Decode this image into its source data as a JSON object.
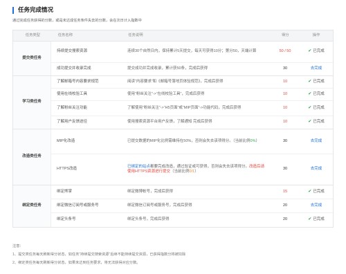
{
  "title": "任务完成情况",
  "intro": "通过完成任务获得的分数，或是未达成任务条件失去的分数，会在次日计入指数中",
  "headers": {
    "type": "任务类型",
    "name": "任务名称",
    "desc": "任务说明",
    "score": "得分",
    "op": "操作"
  },
  "groups": [
    {
      "type": "提交类任务",
      "rows": [
        {
          "name": "持续提交搜索资源",
          "desc": "连续30个自然日内，保持累计5天提交，每天可获得10分；第分50，天端计算",
          "score": "50 / 50",
          "op": "已完成"
        },
        {
          "name": "成功提交并收录完成",
          "desc": "提交成功并完成收录，累计获50条，完成后获得",
          "score": "30",
          "op": "去完成"
        }
      ]
    },
    {
      "type": "学习类任务",
      "rows": [
        {
          "name": "了解邮箱号内容要求规范",
          "desc": "阅读“内容要求”和《邮箱号落地页体验规范》，完成后获得",
          "score": "10",
          "op": "已完成"
        },
        {
          "name": "使用在线校验工具",
          "desc": "使用“粉丝关注”->“在线校验工具”，完成后获得",
          "score": "10",
          "op": "已完成"
        },
        {
          "name": "了解粉丝关注功能",
          "desc": "了解使用“粉丝关注”->“H5页面”或“MIP页面”->功能代码，完成后获得",
          "score": "10",
          "op": "已完成"
        },
        {
          "name": "了解用户反馈途径",
          "desc": "使用搜索资源平台用户反馈，了解通知 完成后获得",
          "score": "10",
          "op": "已完成"
        }
      ]
    },
    {
      "type": "改造类任务",
      "rows": [
        {
          "name": "MIP化改造",
          "desc_main": "已提交数据的MIP化比例需维持在50%，否则会失去该项得分。（当前比例",
          "desc_val": "0%",
          "desc_end": "）",
          "score": "30",
          "op": "去完成"
        },
        {
          "name": "HTTPS改造",
          "desc_a": "已绑定的站点",
          "desc_b": "都要完成改造，通过验证或可获得，否则会失去该项得分。",
          "desc_c": "改造后请使用HTTPS资源进行提交",
          "desc_d": "（当前比例",
          "desc_val": "0/1",
          "desc_end": "）",
          "score": "30",
          "op": "去完成"
        }
      ]
    },
    {
      "type": "绑定类任务",
      "rows": [
        {
          "name": "绑定熊掌",
          "desc": "绑定微博帐号，完成后获得",
          "score": "15",
          "op": "已完成"
        },
        {
          "name": "绑定微信订阅号或服务号",
          "desc": "绑定微信订阅号或服务号，完成后获得",
          "score": "20",
          "op": "去完成"
        },
        {
          "name": "绑定头条号",
          "desc": "绑定头条号，完成后获得",
          "score": "20",
          "op": "已完成"
        }
      ]
    }
  ],
  "notes": {
    "label": "注意：",
    "n1": "1、提交类任务每天刷新得分状态，如任务“持续提交搜索资源”后续不能持续提交资源，已获得指数分将被扣除",
    "n2": "2、绑定类任务每天刷新得分状态，如果未达到任务要求，将无法获得对应分数。"
  }
}
